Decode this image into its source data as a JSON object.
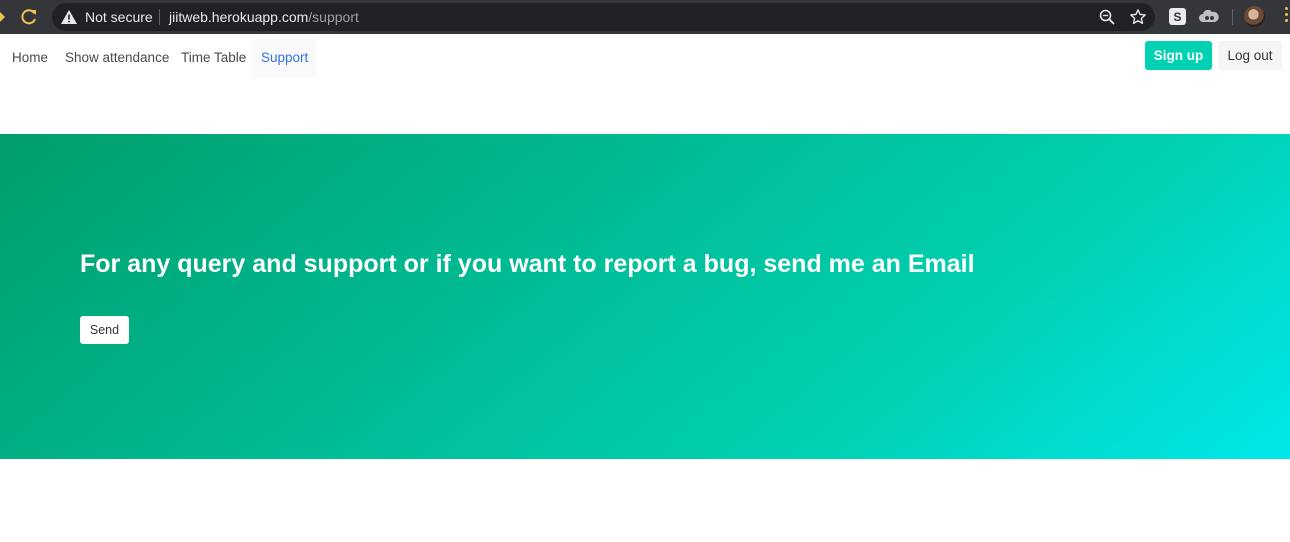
{
  "browser": {
    "security_label": "Not secure",
    "url_host": "jiitweb.herokuapp.com",
    "url_path": "/support",
    "extension_s_label": "S"
  },
  "nav": {
    "items": [
      {
        "label": "Home"
      },
      {
        "label": "Show attendance"
      },
      {
        "label": "Time Table"
      },
      {
        "label": "Support",
        "active": true
      }
    ],
    "signup_label": "Sign up",
    "logout_label": "Log out"
  },
  "hero": {
    "title": "For any query and support or if you want to report a bug, send me an Email",
    "send_label": "Send"
  },
  "colors": {
    "primary": "#00d1b2",
    "link": "#3273dc",
    "hero_gradient_start": "#009e6c",
    "hero_gradient_end": "#00e7eb"
  }
}
